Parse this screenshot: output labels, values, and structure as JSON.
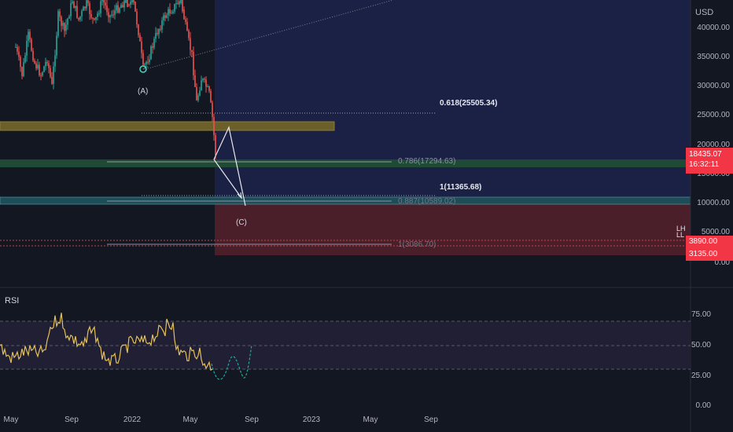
{
  "price_axis": {
    "currency": "USD",
    "ticks": [
      "40000.00",
      "35000.00",
      "30000.00",
      "25000.00",
      "20000.00",
      "15000.00",
      "10000.00",
      "5000.00",
      "0.00"
    ]
  },
  "price_tags": {
    "current_price": "18435.07",
    "countdown": "16:32:11",
    "tag_a": "3890.00",
    "tag_b": "3135.00",
    "tag_glyphs": "LH\nLL"
  },
  "fib_labels": {
    "f618": "0.618(25505.34)",
    "f786": "0.786(17294.63)",
    "f1_upper": "1(11365.68)",
    "f887": "0.887(10589.02)",
    "f1_lower": "1(3086.70)"
  },
  "wave_labels": {
    "a": "(A)",
    "c": "(C)"
  },
  "rsi": {
    "title": "RSI",
    "ticks": [
      "75.00",
      "50.00",
      "25.00",
      "0.00"
    ]
  },
  "time_axis": {
    "ticks": [
      "May",
      "Sep",
      "2022",
      "May",
      "Sep",
      "2023",
      "May",
      "Sep"
    ]
  },
  "colors": {
    "background": "#131722",
    "projection_zone": "#1b2145",
    "red_zone": "#4a1f29",
    "rsi_band": "#211f33",
    "candle_up": "#26a69a",
    "candle_down": "#ef5350",
    "yellow_zone": "#6b5f2a",
    "green_zone": "#1f4a36",
    "teal_zone": "#1d4d57",
    "rsi_line": "#e3c15a",
    "rsi_projection": "#26a69a",
    "red_tag": "#f23645"
  }
}
